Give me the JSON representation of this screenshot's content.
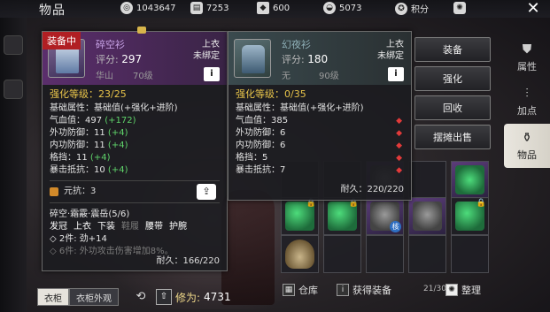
{
  "window": {
    "title": "物品"
  },
  "resources": [
    {
      "icon": "silver-coin-icon",
      "value": "1043647"
    },
    {
      "icon": "gold-ingot-icon",
      "value": "7253"
    },
    {
      "icon": "jade-icon",
      "value": "600"
    },
    {
      "icon": "yuanbao-icon",
      "value": "5073"
    },
    {
      "icon": "points-icon",
      "value": "积分"
    }
  ],
  "side_menu": [
    {
      "label": "属性",
      "icon": "attribute-icon",
      "active": false
    },
    {
      "label": "加点",
      "icon": "sliders-icon",
      "active": false
    },
    {
      "label": "物品",
      "icon": "bag-icon",
      "active": true
    }
  ],
  "actions": [
    "装备",
    "强化",
    "回收",
    "摆摊出售"
  ],
  "equipped_item": {
    "tag": "装备中",
    "name": "碎空衫",
    "score_label": "评分:",
    "score": "297",
    "sect": "华山",
    "level": "70级",
    "slot": "上衣",
    "bind": "未绑定",
    "info": "i",
    "enhance": "强化等级：23/25",
    "attr_header": "基础属性：基础值(+强化+进阶)",
    "stats": [
      {
        "label": "气血值：",
        "value": "497",
        "bonus": "(+172)"
      },
      {
        "label": "外功防御：",
        "value": "11",
        "bonus": "(+4)"
      },
      {
        "label": "内功防御：",
        "value": "11",
        "bonus": "(+4)"
      },
      {
        "label": "格挡：",
        "value": "11",
        "bonus": "(+4)"
      },
      {
        "label": "暴击抵抗：",
        "value": "10",
        "bonus": "(+4)"
      }
    ],
    "yuankang": "元抗：3",
    "set_name": "碎空·霜霰·震岳(5/6)",
    "set_parts": [
      {
        "name": "发冠",
        "owned": true
      },
      {
        "name": "上衣",
        "owned": true
      },
      {
        "name": "下装",
        "owned": true
      },
      {
        "name": "鞋履",
        "owned": false
      },
      {
        "name": "腰带",
        "owned": true
      },
      {
        "name": "护腕",
        "owned": true
      }
    ],
    "set_bonus_2": "◇ 2件: 劲+14",
    "set_bonus_6": "◇ 6件: 外功攻击伤害增加8%。",
    "durability": "耐久：166/220"
  },
  "compare_item": {
    "name": "幻夜衫",
    "score_label": "评分:",
    "score": "180",
    "sect": "无",
    "level": "90级",
    "slot": "上衣",
    "bind": "未绑定",
    "info": "i",
    "enhance": "强化等级：0/35",
    "attr_header": "基础属性：基础值(+强化+进阶)",
    "stats": [
      {
        "label": "气血值：",
        "value": "385"
      },
      {
        "label": "外功防御：",
        "value": "6"
      },
      {
        "label": "内功防御：",
        "value": "6"
      },
      {
        "label": "格挡：",
        "value": "5"
      },
      {
        "label": "暴击抵抗：",
        "value": "7"
      }
    ],
    "durability": "耐久：220/220"
  },
  "inventory": {
    "badge": "核"
  },
  "bottom_bar": {
    "warehouse": "仓库",
    "get_equipment": "获得装备",
    "count": "21/30",
    "organize": "整理"
  },
  "left_bottom": {
    "wardrobe": "衣柜",
    "wardrobe_appearance": "衣柜外观",
    "xiuwei_label": "修为:",
    "xiuwei_value": "4731"
  }
}
